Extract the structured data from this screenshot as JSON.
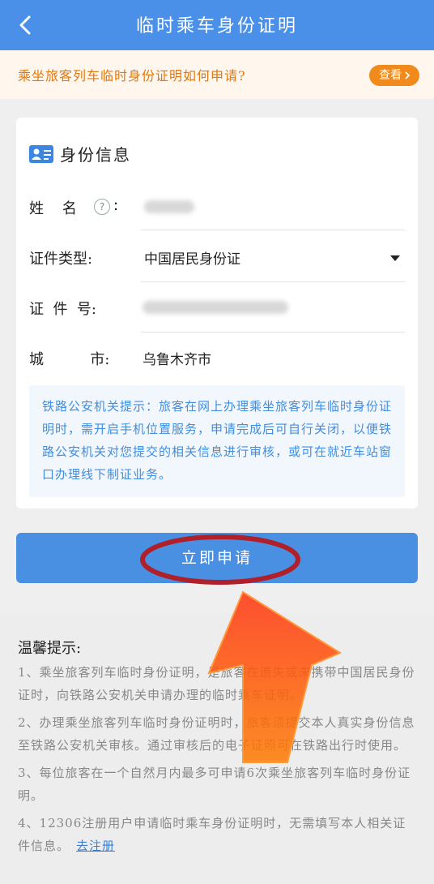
{
  "header": {
    "title": "临时乘车身份证明"
  },
  "notice": {
    "text": "乘坐旅客列车临时身份证明如何申请?",
    "button_label": "查看"
  },
  "card": {
    "title": "身份信息",
    "name_label": "姓    名",
    "help_glyph": "?",
    "id_type_label": "证件类型:",
    "id_type_value": "中国居民身份证",
    "id_no_label": "证  件  号:",
    "city_label": "城          市:",
    "city_value": "乌鲁木齐市",
    "hint": "铁路公安机关提示：旅客在网上办理乘坐旅客列车临时身份证明时，需开启手机位置服务，申请完成后可自行关闭，以便铁路公安机关对您提交的相关信息进行审核，或可在就近车站窗口办理线下制证业务。"
  },
  "apply_button": "立即申请",
  "tips": {
    "title": "温馨提示:",
    "items": [
      "1、乘坐旅客列车临时身份证明，是旅客在遗失或未携带中国居民身份证时，向铁路公安机关申请办理的临时乘车证明。",
      "2、办理乘坐旅客列车临时身份证明时，旅客须提交本人真实身份信息至铁路公安机关审核。通过审核后的电子证照可在铁路出行时使用。",
      "3、每位旅客在一个自然月内最多可申请6次乘坐旅客列车临时身份证明。",
      "4、12306注册用户申请临时乘车身份证明时，无需填写本人相关证件信息。"
    ],
    "register_link": "去注册"
  },
  "colors": {
    "header_bg": "#4a8fe8",
    "accent_orange": "#f08a1c",
    "hint_blue": "#3f8ee2",
    "annotation_red": "#b0202a"
  },
  "icons": [
    "back-icon",
    "chevron-right-icon",
    "id-card-icon",
    "help-icon",
    "dropdown-caret-icon"
  ]
}
